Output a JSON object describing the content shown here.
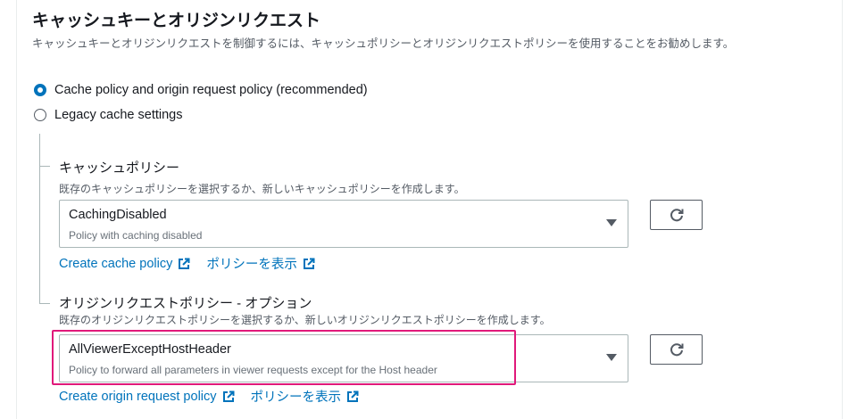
{
  "section": {
    "title": "キャッシュキーとオリジンリクエスト",
    "description": "キャッシュキーとオリジンリクエストを制御するには、キャッシュポリシーとオリジンリクエストポリシーを使用することをお勧めします。"
  },
  "options": [
    {
      "label": "Cache policy and origin request policy (recommended)",
      "selected": true
    },
    {
      "label": "Legacy cache settings",
      "selected": false
    }
  ],
  "cache_policy": {
    "label": "キャッシュポリシー",
    "description": "既存のキャッシュポリシーを選択するか、新しいキャッシュポリシーを作成します。",
    "selected_value": "CachingDisabled",
    "selected_description": "Policy with caching disabled",
    "create_link": "Create cache policy",
    "view_link": "ポリシーを表示"
  },
  "origin_request_policy": {
    "label": "オリジンリクエストポリシー - オプション",
    "description": "既存のオリジンリクエストポリシーを選択するか、新しいオリジンリクエストポリシーを作成します。",
    "selected_value": "AllViewerExceptHostHeader",
    "selected_description": "Policy to forward all parameters in viewer requests except for the Host header",
    "create_link": "Create origin request policy",
    "view_link": "ポリシーを表示"
  },
  "colors": {
    "link": "#0073bb",
    "highlight": "#e0197a",
    "radio_selected": "#0073bb"
  },
  "icons": {
    "refresh": "refresh-icon",
    "external": "external-link-icon",
    "caret": "caret-down-icon"
  }
}
